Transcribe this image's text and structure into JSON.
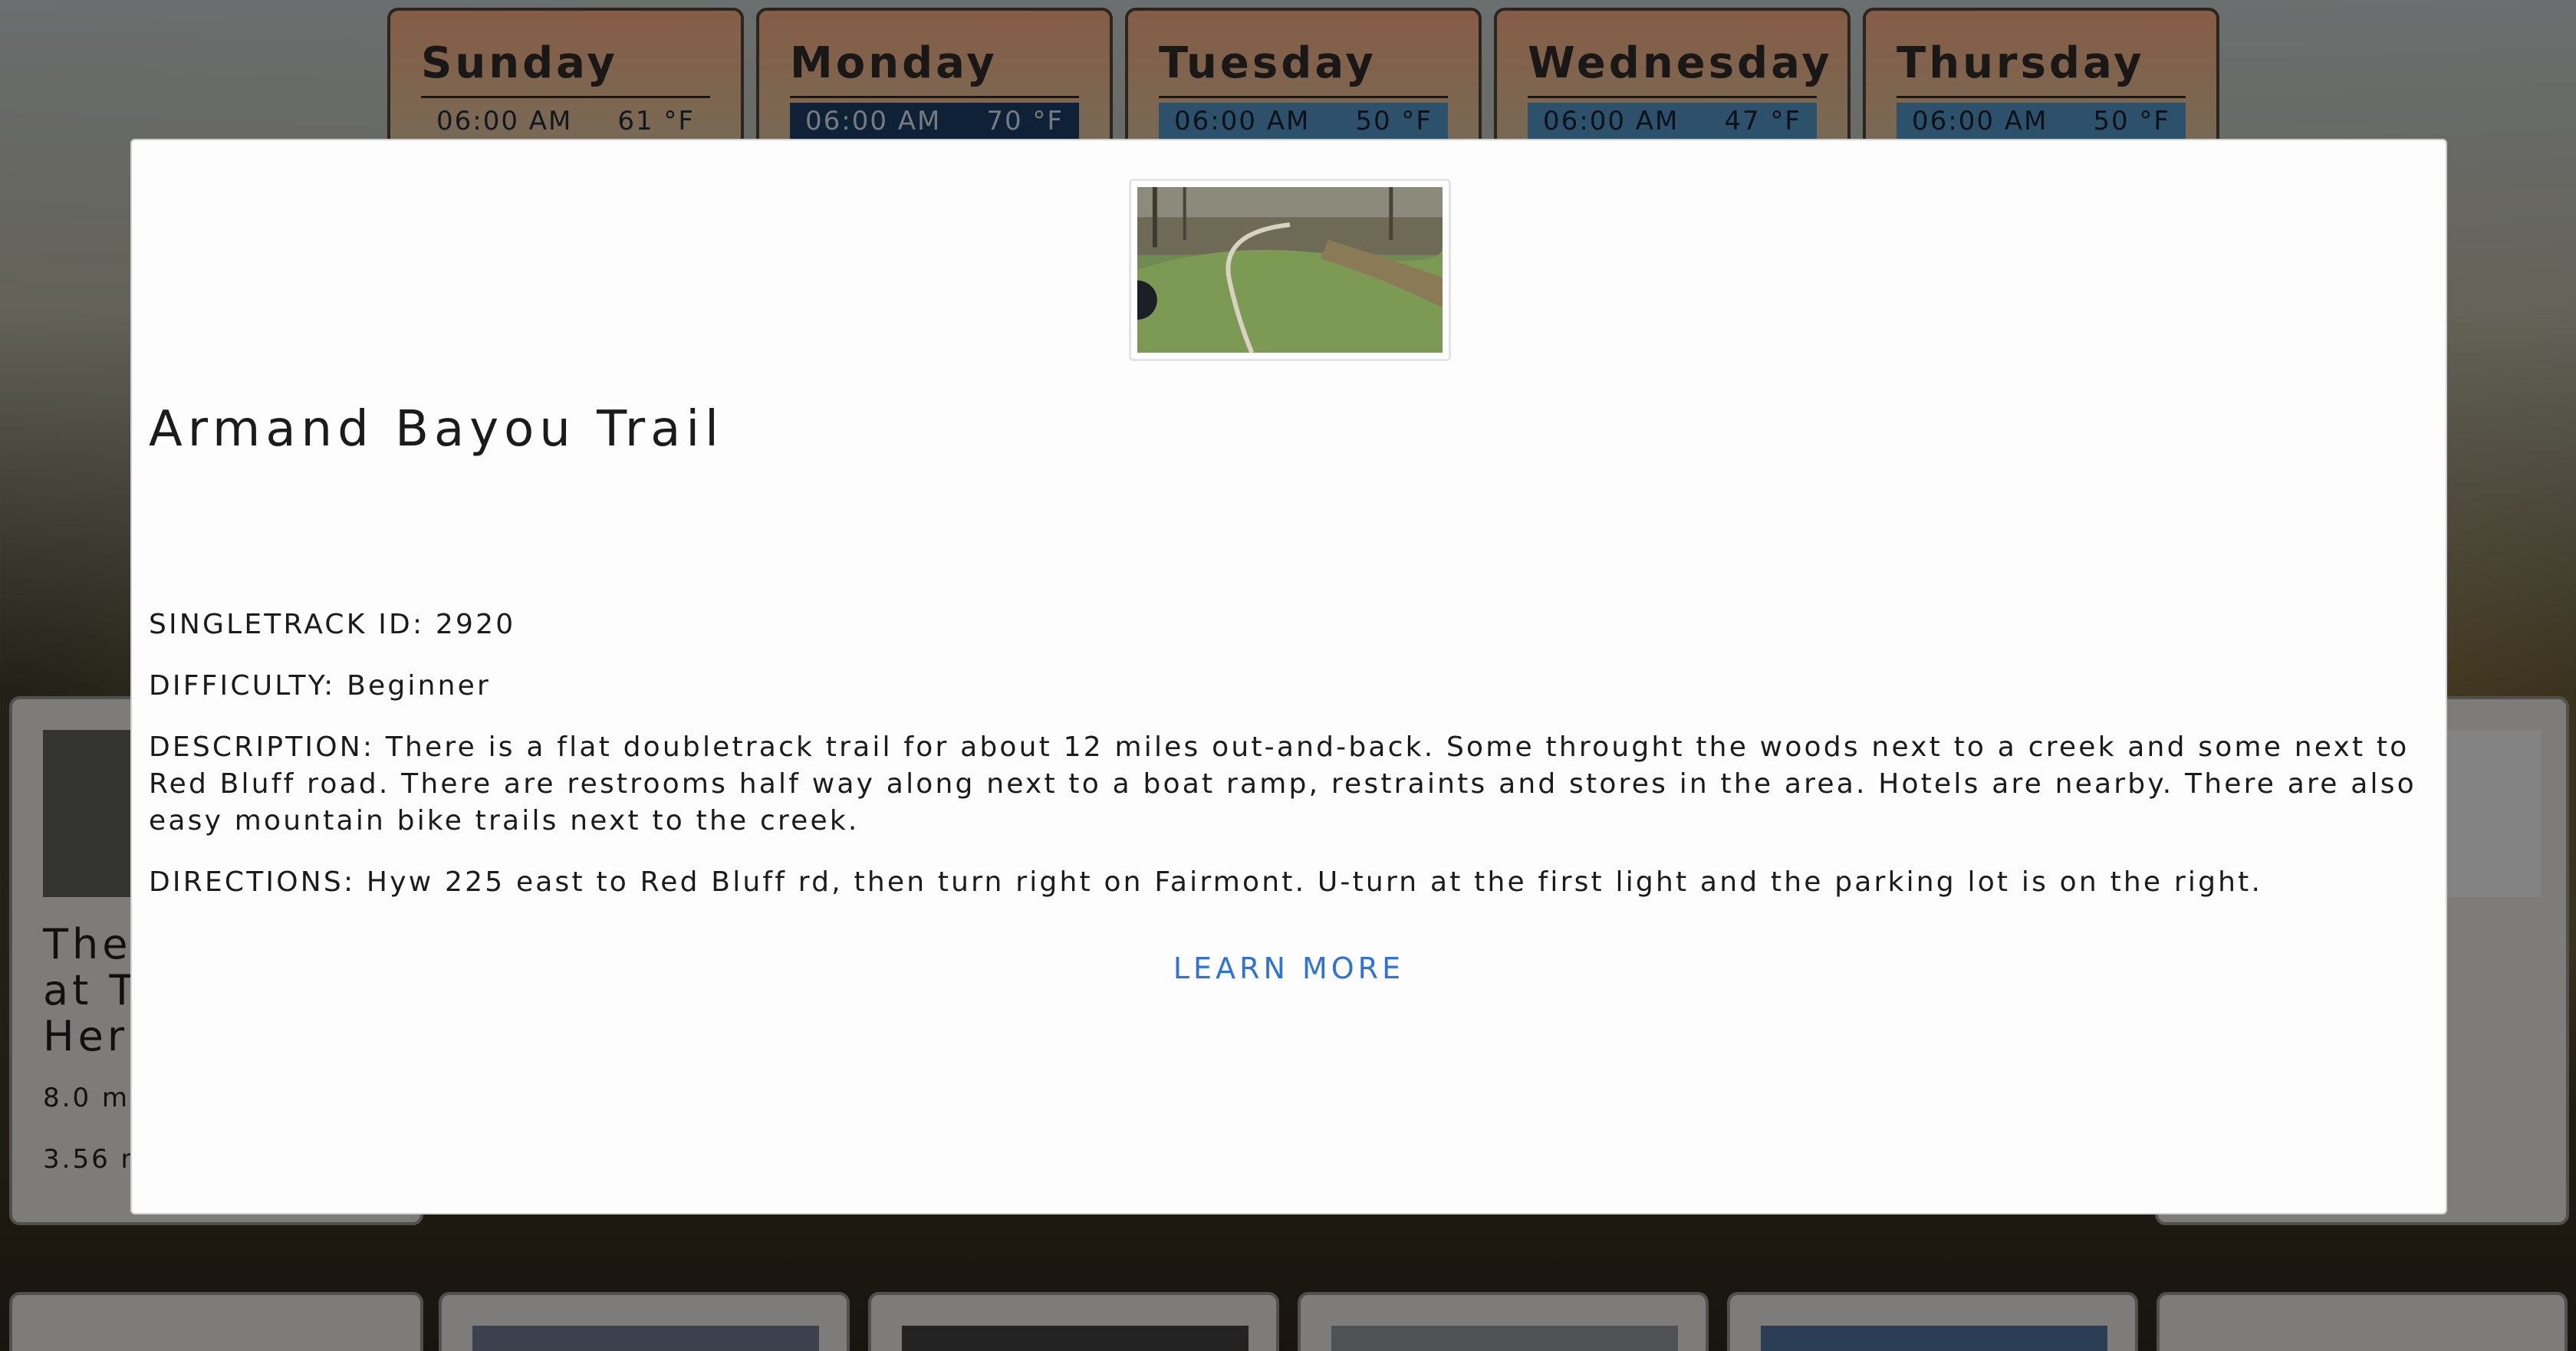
{
  "weather": [
    {
      "day": "Sunday",
      "time": "06:00 AM",
      "temp": "61 °F"
    },
    {
      "day": "Monday",
      "time": "06:00 AM",
      "temp": "70 °F"
    },
    {
      "day": "Tuesday",
      "time": "06:00 AM",
      "temp": "50 °F"
    },
    {
      "day": "Wednesday",
      "time": "06:00 AM",
      "temp": "47 °F"
    },
    {
      "day": "Thursday",
      "time": "06:00 AM",
      "temp": "50 °F"
    }
  ],
  "background_card": {
    "title_fragment": "The\nat T\nHer",
    "meta_1": "8.0 m",
    "meta_2": "3.56 r"
  },
  "modal": {
    "title": "Armand Bayou Trail",
    "singletrack_id": "SINGLETRACK ID: 2920",
    "difficulty": "DIFFICULTY: Beginner",
    "description": "DESCRIPTION: There is a flat doubletrack trail for about 12 miles out-and-back. Some throught the woods next to a creek and some next to Red Bluff road. There are restrooms half way along next to a boat ramp, restraints and stores in the area. Hotels are nearby. There are also easy mountain bike trails next to the creek.",
    "directions": "DIRECTIONS: Hyw 225 east to Red Bluff rd, then turn right on Fairmont. U-turn at the first light and the parking lot is on the right.",
    "learn_more": "LEARN MORE"
  }
}
